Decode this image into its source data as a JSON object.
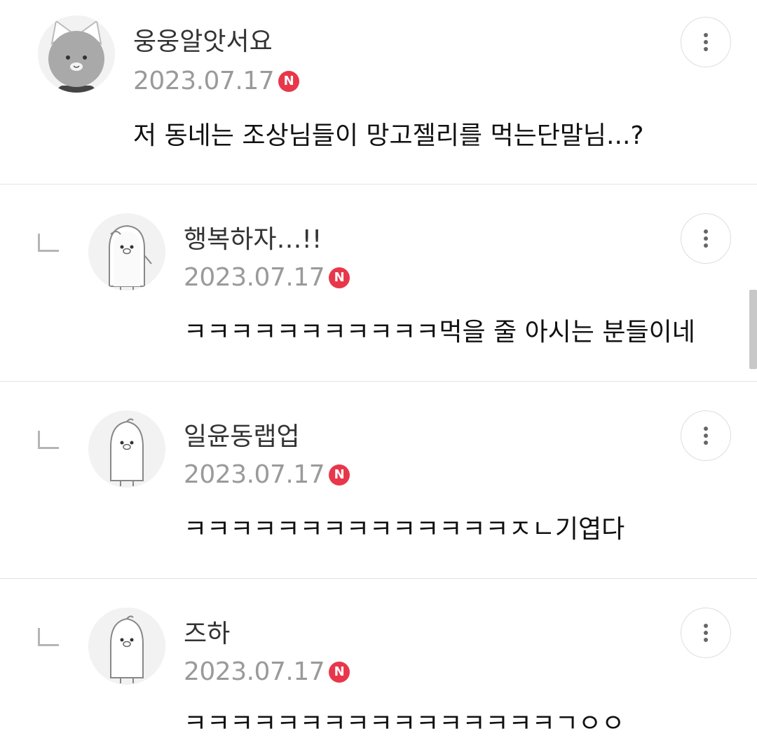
{
  "comments": [
    {
      "nickname": "웅웅알앗서요",
      "date": "2023.07.17",
      "badge": "N",
      "text": "저 동네는 조상님들이 망고젤리를 먹는단말님...?",
      "avatar_icon": "cat-avatar-icon",
      "is_reply": false
    },
    {
      "nickname": "행복하자…!!",
      "date": "2023.07.17",
      "badge": "N",
      "text": "ㅋㅋㅋㅋㅋㅋㅋㅋㅋㅋㅋ먹을 줄 아시는 분들이네",
      "avatar_icon": "penguin-waving-avatar-icon",
      "is_reply": true
    },
    {
      "nickname": "일윤동랩업",
      "date": "2023.07.17",
      "badge": "N",
      "text": "ㅋㅋㅋㅋㅋㅋㅋㅋㅋㅋㅋㅋㅋㅋㅈㄴ기엽다",
      "avatar_icon": "penguin-avatar-icon",
      "is_reply": true
    },
    {
      "nickname": "즈하",
      "date": "2023.07.17",
      "badge": "N",
      "text": "ㅋㅋㅋㅋㅋㅋㅋㅋㅋㅋㅋㅋㅋㅋㅋㅋㄱㅇㅇ",
      "avatar_icon": "penguin-avatar-icon",
      "is_reply": true
    }
  ],
  "colors": {
    "badge": "#e8374a",
    "date": "#9a9a9a",
    "divider": "#e4e4e4"
  }
}
